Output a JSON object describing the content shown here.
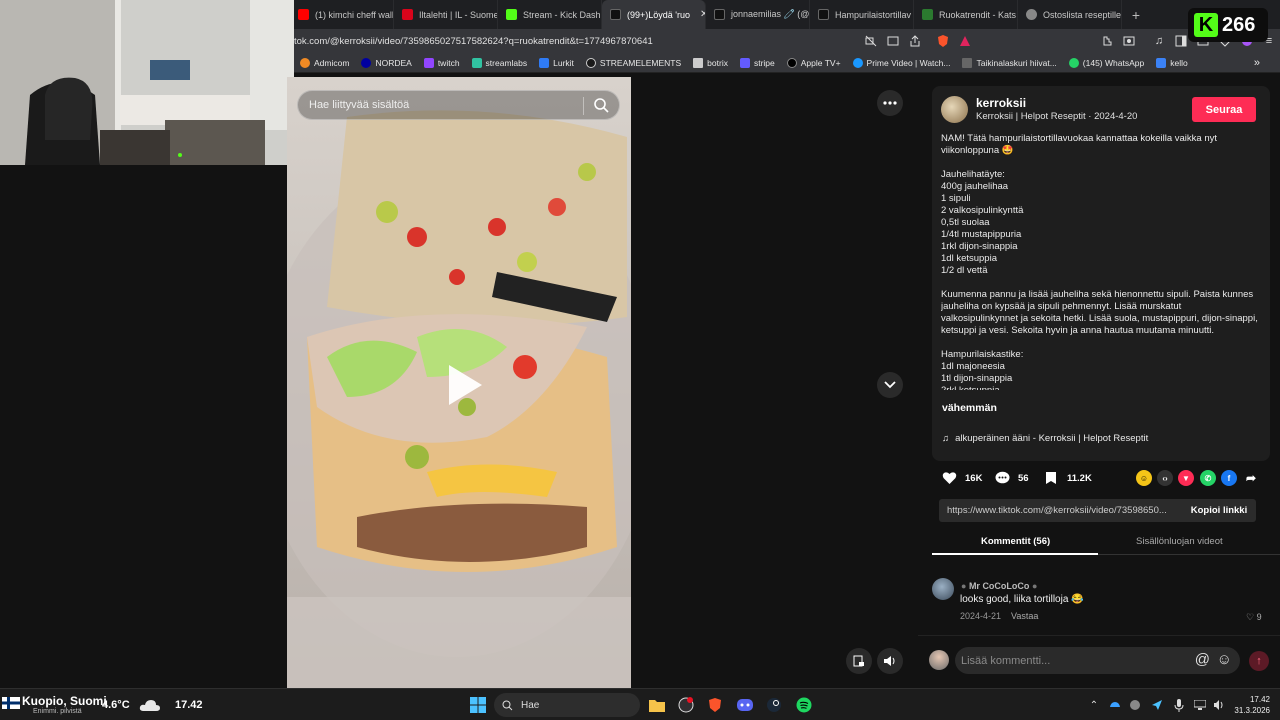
{
  "browser": {
    "tabs": [
      {
        "label": "(1) kimchi cheff wall",
        "color": "#ff0000"
      },
      {
        "label": "Iltalehti | IL - Suome",
        "color": "#d9041b"
      },
      {
        "label": "Stream - Kick Dashb",
        "color": "#53fc18"
      },
      {
        "label": "(99+)Löydä 'ruo",
        "color": "#111111",
        "active": true
      },
      {
        "label": "jonnaemilias 🧷 (@",
        "color": "#111111"
      },
      {
        "label": "Hampurilaistortillav",
        "color": "#111111"
      },
      {
        "label": "Ruokatrendit - Kats",
        "color": "#2b7a2f"
      },
      {
        "label": "Ostoslista reseptille",
        "color": "#888888"
      }
    ],
    "new_tab": "+",
    "url": "tok.com/@kerroksii/video/7359865027517582624?q=ruokatrendit&t=1774967870641",
    "bookmarks": [
      {
        "label": "Admicom",
        "color": "#f08a24"
      },
      {
        "label": "NORDEA",
        "color": "#0000a0"
      },
      {
        "label": "twitch",
        "color": "#9146ff"
      },
      {
        "label": "streamlabs",
        "color": "#31c3a2"
      },
      {
        "label": "Lurkit",
        "color": "#2f7bf5"
      },
      {
        "label": "STREAMELEMENTS",
        "color": "#1a1a1a"
      },
      {
        "label": "botrix",
        "color": "#cccccc"
      },
      {
        "label": "stripe",
        "color": "#635bff"
      },
      {
        "label": "Apple TV+",
        "color": "#000000"
      },
      {
        "label": "Prime Video | Watch...",
        "color": "#1a98ff"
      },
      {
        "label": "Taikinalaskuri hiivat...",
        "color": "#666666"
      },
      {
        "label": "(145) WhatsApp",
        "color": "#25d366"
      },
      {
        "label": "kello",
        "color": "#3b82f6"
      }
    ],
    "bookmarks_more": "»"
  },
  "kick": {
    "count": "266",
    "logo": "K"
  },
  "video": {
    "search_placeholder": "Hae liittyvää sisältöä",
    "more_icon": "more-icon"
  },
  "post": {
    "username": "kerroksii",
    "meta": "Kerroksii | Helpot Reseptit · 2024-4-20",
    "follow": "Seuraa",
    "description": "NAM! Tätä hampurilaistortillavuokaa kannattaa kokeilla vaikka nyt viikonloppuna 🤩\n\nJauhelihatäyte:\n400g jauhelihaa\n1 sipuli\n2 valkosipulinkynttä\n0,5tl suolaa\n1/4tl mustapippuria\n1rkl dijon-sinappia\n1dl ketsuppia\n1/2 dl vettä\n\nKuumenna pannu ja lisää jauheliha sekä hienonnettu sipuli. Paista kunnes jauheliha on kypsää ja sipuli pehmennyt. Lisää murskatut valkosipulinkynnet ja sekoita hetki. Lisää suola, mustapippuri, dijon-sinappi, ketsuppi ja vesi. Sekoita hyvin ja anna hautua muutama minuutti.\n\nHampurilaiskastike:\n1dl majoneesia\n1tl dijon-sinappia\n2rkl ketsuppia",
    "less": "vähemmän",
    "music": "alkuperäinen ääni - Kerroksii | Helpot Reseptit",
    "likes": "16K",
    "comments": "56",
    "saves": "11.2K",
    "link": "https://www.tiktok.com/@kerroksii/video/73598650...",
    "copy_link": "Kopioi linkki",
    "tab_comments": "Kommentit (56)",
    "tab_creator": "Sisällönluojan videot"
  },
  "comment": {
    "name": "Mr CoCoLoCo",
    "text": "looks good, liika tortilloja 😂",
    "date": "2024-4-21",
    "reply": "Vastaa",
    "likes": "9"
  },
  "comment_input": {
    "placeholder": "Lisää kommentti..."
  },
  "taskbar": {
    "weather_location": "Kuopio, Suomi",
    "weather_desc": "Enimmi. pilvistä",
    "temperature": "4.6°C",
    "time_overlay": "17.42",
    "search_label": "Hae",
    "clock_time": "17.42",
    "clock_date": "31.3.2026"
  }
}
